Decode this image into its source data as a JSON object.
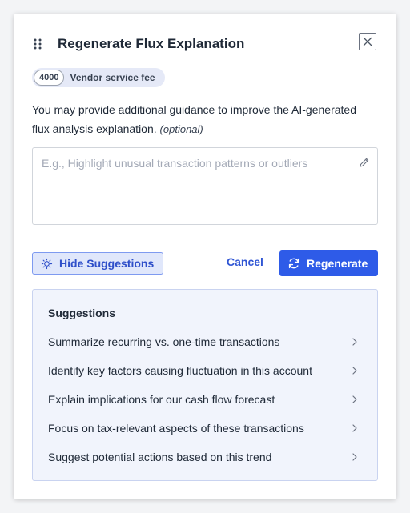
{
  "dialog": {
    "title": "Regenerate Flux Explanation",
    "close_icon": "close-icon",
    "drag_icon": "drag-handle-icon"
  },
  "account_chip": {
    "code": "4000",
    "label": "Vendor service fee"
  },
  "guidance": {
    "text": "You may provide additional guidance to improve the AI-generated flux analysis explanation.",
    "optional_label": "(optional)"
  },
  "input": {
    "placeholder": "E.g., Highlight unusual transaction patterns or outliers",
    "value": "",
    "icon": "pencil-icon"
  },
  "actions": {
    "hide_suggestions_label": "Hide Suggestions",
    "hide_suggestions_icon": "lightbulb-icon",
    "cancel_label": "Cancel",
    "regenerate_label": "Regenerate",
    "regenerate_icon": "refresh-icon"
  },
  "suggestions": {
    "title": "Suggestions",
    "items": [
      {
        "label": "Summarize recurring vs. one-time transactions"
      },
      {
        "label": "Identify key factors causing fluctuation in this account"
      },
      {
        "label": "Explain implications for our cash flow forecast"
      },
      {
        "label": "Focus on tax-relevant aspects of these transactions"
      },
      {
        "label": "Suggest potential actions based on this trend"
      }
    ]
  },
  "colors": {
    "primary": "#2e5be8",
    "primary_text": "#2f55d4",
    "suggest_bg": "#f1f4fc",
    "chip_bg": "#e5e9f7"
  }
}
